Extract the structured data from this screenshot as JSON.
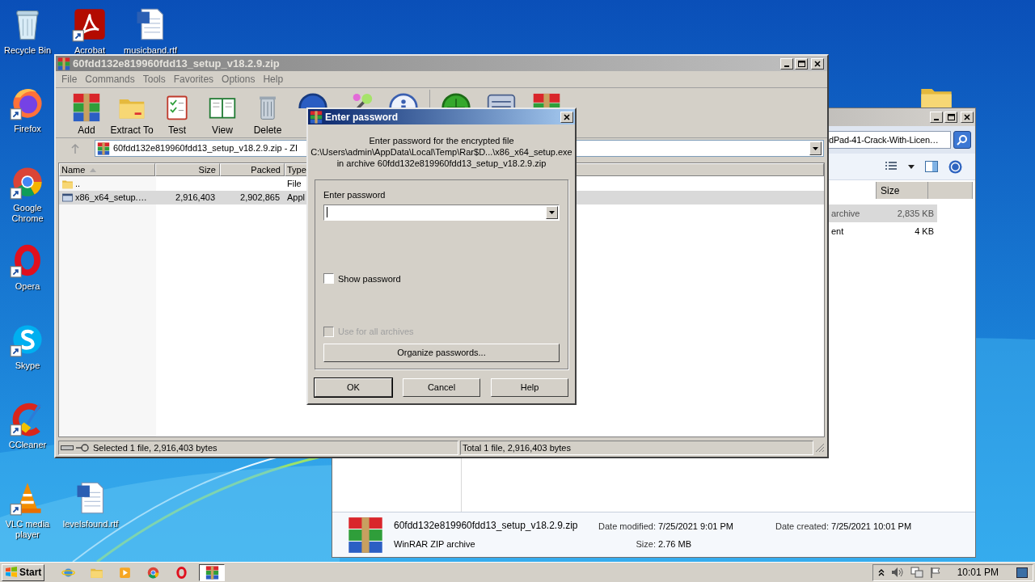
{
  "desktop": {
    "icons": [
      {
        "label": "Recycle Bin",
        "kind": "recycle",
        "shortcut": false
      },
      {
        "label": "Acrobat",
        "kind": "acrobat",
        "shortcut": true
      },
      {
        "label": "musicband.rtf",
        "kind": "word",
        "shortcut": false
      },
      {
        "label": "Firefox",
        "kind": "firefox",
        "shortcut": true
      },
      {
        "label": "Google Chrome",
        "kind": "chrome",
        "shortcut": true
      },
      {
        "label": "Opera",
        "kind": "opera",
        "shortcut": true
      },
      {
        "label": "Skype",
        "kind": "skype",
        "shortcut": true
      },
      {
        "label": "CCleaner",
        "kind": "ccleaner",
        "shortcut": true
      },
      {
        "label": "VLC media player",
        "kind": "vlc",
        "shortcut": true
      },
      {
        "label": "levelsfound.rtf",
        "kind": "word",
        "shortcut": false
      },
      {
        "kind": "folder",
        "shortcut": false
      }
    ]
  },
  "explorer": {
    "search": "dPad-41-Crack-With-Licen…",
    "columns": [
      "Size"
    ],
    "rows": [
      {
        "type": "archive",
        "size": "2,835 KB",
        "selected": true
      },
      {
        "type": "ent",
        "size": "4 KB",
        "selected": false
      }
    ],
    "details": {
      "name": "60fdd132e819960fdd13_setup_v18.2.9.zip",
      "type": "WinRAR ZIP archive",
      "fields": [
        {
          "label": "Date modified:",
          "value": "7/25/2021 9:01 PM"
        },
        {
          "label": "Size:",
          "value": "2.76 MB"
        },
        {
          "label": "Date created:",
          "value": "7/25/2021 10:01 PM"
        }
      ]
    }
  },
  "winrar": {
    "title": "60fdd132e819960fdd13_setup_v18.2.9.zip",
    "menu": [
      "File",
      "Commands",
      "Tools",
      "Favorites",
      "Options",
      "Help"
    ],
    "toolbar": [
      {
        "label": "Add",
        "kind": "add"
      },
      {
        "label": "Extract To",
        "kind": "extract"
      },
      {
        "label": "Test",
        "kind": "test"
      },
      {
        "label": "View",
        "kind": "view"
      },
      {
        "label": "Delete",
        "kind": "delete"
      },
      {
        "kind": "find"
      },
      {
        "kind": "wizard"
      },
      {
        "kind": "info"
      },
      {
        "kind": "separator"
      },
      {
        "kind": "virus"
      },
      {
        "kind": "comment"
      },
      {
        "kind": "sfx"
      }
    ],
    "address": "60fdd132e819960fdd13_setup_v18.2.9.zip - ZI",
    "columns": [
      {
        "label": "Name",
        "sorted": true
      },
      {
        "label": "Size"
      },
      {
        "label": "Packed"
      },
      {
        "label": "Type"
      }
    ],
    "rows": [
      {
        "name": "..",
        "kind": "folder",
        "type": "File",
        "selected": false
      },
      {
        "name": "x86_x64_setup.…",
        "kind": "exe",
        "size": "2,916,403",
        "packed": "2,902,865",
        "type": "Appl",
        "selected": true
      }
    ],
    "status": [
      "Selected 1 file, 2,916,403 bytes",
      "Total 1 file, 2,916,403 bytes"
    ]
  },
  "password_dialog": {
    "title": "Enter password",
    "message": [
      "Enter password for the encrypted file",
      "C:\\Users\\admin\\AppData\\Local\\Temp\\Rar$D...\\x86_x64_setup.exe",
      "in archive 60fdd132e819960fdd13_setup_v18.2.9.zip"
    ],
    "field_label": "Enter password",
    "checkboxes": [
      {
        "label": "Show password",
        "checked": false,
        "disabled": false
      },
      {
        "label": "Use for all archives",
        "checked": false,
        "disabled": true
      }
    ],
    "organize_button": "Organize passwords...",
    "buttons": [
      {
        "label": "OK",
        "default": true
      },
      {
        "label": "Cancel",
        "default": false
      },
      {
        "label": "Help",
        "default": false
      }
    ]
  },
  "taskbar": {
    "start": "Start",
    "apps": [
      {
        "kind": "ie",
        "selected": false
      },
      {
        "kind": "explorer",
        "selected": false
      },
      {
        "kind": "media",
        "selected": false
      },
      {
        "kind": "chrome",
        "selected": false
      },
      {
        "kind": "opera",
        "selected": false
      },
      {
        "kind": "winrar",
        "selected": true
      }
    ],
    "clock": "10:01 PM"
  }
}
